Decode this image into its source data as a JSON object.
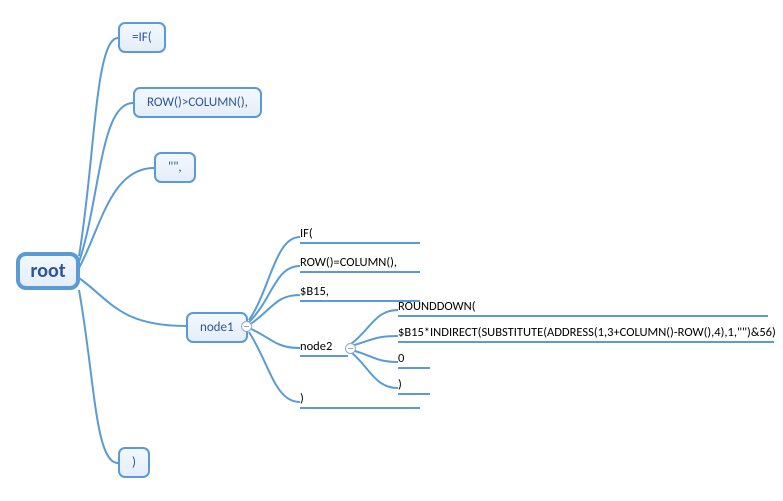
{
  "root_label": "root",
  "root_children": [
    {
      "label": "=IF("
    },
    {
      "label": "ROW()>COLUMN(),"
    },
    {
      "label": "\"\","
    }
  ],
  "root_close": {
    "label": ")"
  },
  "node1": {
    "label": "node1",
    "children": [
      {
        "label": "IF("
      },
      {
        "label": "ROW()=COLUMN(),"
      },
      {
        "label": "$B15,"
      }
    ],
    "close": {
      "label": ")"
    }
  },
  "node2": {
    "label": "node2",
    "children": [
      {
        "label": "ROUNDDOWN("
      },
      {
        "label": "$B15*INDIRECT(SUBSTITUTE(ADDRESS(1,3+COLUMN()-ROW(),4),1,\"\")&56)"
      },
      {
        "label": "0"
      },
      {
        "label": ")"
      }
    ]
  }
}
